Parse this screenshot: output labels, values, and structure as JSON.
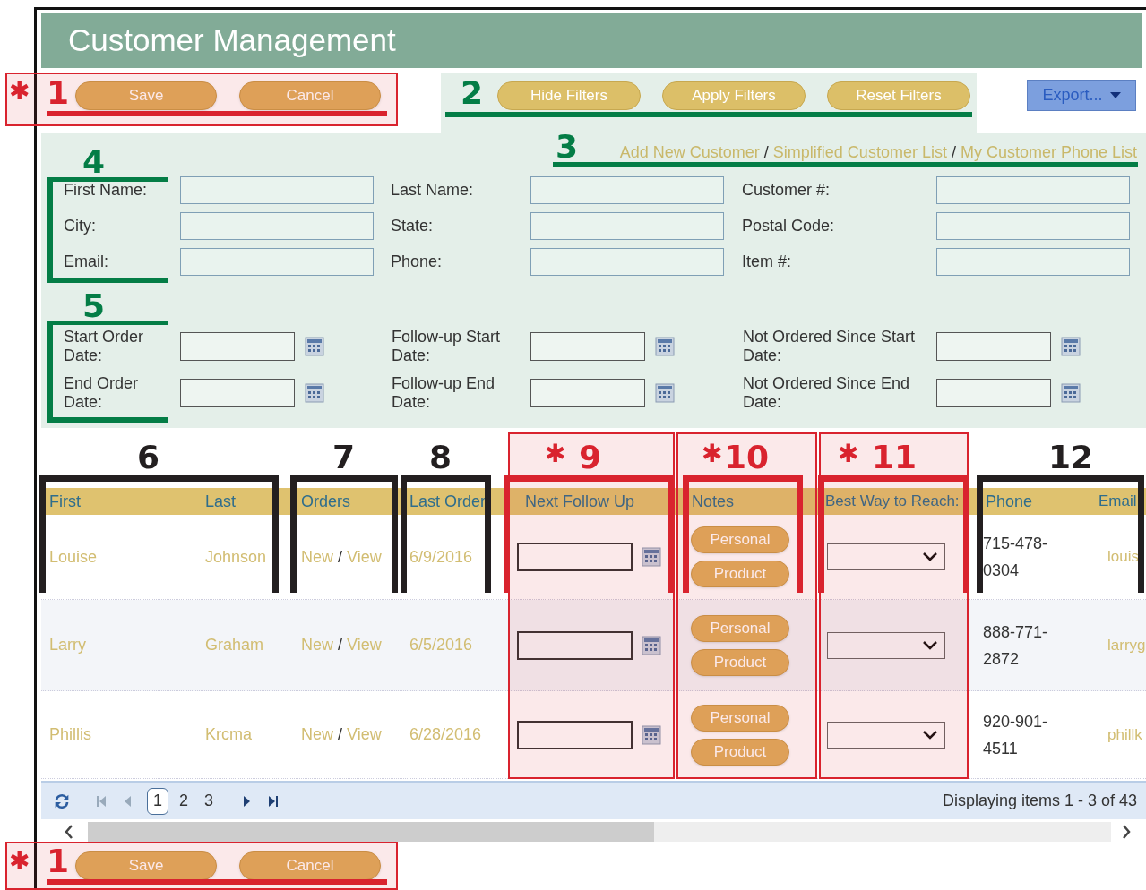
{
  "title": "Customer Management",
  "action_buttons": [
    "Save",
    "Cancel"
  ],
  "filter_buttons": [
    "Hide Filters",
    "Apply Filters",
    "Reset Filters"
  ],
  "export_button": {
    "label": "Export..."
  },
  "links": [
    {
      "label": "Add New Customer"
    },
    {
      "label": "Simplified Customer List",
      "separator": "/"
    },
    {
      "label": "My Customer Phone List",
      "separator": "/"
    }
  ],
  "search_fields": [
    {
      "label": "First Name:"
    },
    {
      "label": "Last Name:"
    },
    {
      "label": "Customer #:"
    },
    {
      "label": "City:"
    },
    {
      "label": "State:"
    },
    {
      "label": "Postal Code:"
    },
    {
      "label": "Email:"
    },
    {
      "label": "Phone:"
    },
    {
      "label": "Item #:"
    }
  ],
  "date_fields": [
    {
      "label": "Start Order Date:"
    },
    {
      "label": "Follow-up Start Date:"
    },
    {
      "label": "Not Ordered Since Start Date:"
    },
    {
      "label": "End Order Date:"
    },
    {
      "label": "Follow-up End Date:"
    },
    {
      "label": "Not Ordered Since End Date:"
    }
  ],
  "table": {
    "columns": [
      "First",
      "Last",
      "Orders",
      "Last Order",
      "Next Follow Up",
      "Notes",
      "Best Way to Reach:",
      "Phone",
      "Email"
    ],
    "rows": [
      {
        "first": "Louise",
        "last": "Johnson",
        "order_new": "New",
        "order_separator": "/",
        "order_view": "View",
        "last_order": "6/9/2016",
        "notes": [
          "Personal",
          "Product"
        ],
        "phone": "715-478-0304",
        "email": "louis"
      },
      {
        "first": "Larry",
        "last": "Graham",
        "order_new": "New",
        "order_separator": "/",
        "order_view": "View",
        "last_order": "6/5/2016",
        "notes": [
          "Personal",
          "Product"
        ],
        "phone": "888-771-2872",
        "email": "larryg"
      },
      {
        "first": "Phillis",
        "last": "Krcma",
        "order_new": "New",
        "order_separator": "/",
        "order_view": "View",
        "last_order": "6/28/2016",
        "notes": [
          "Personal",
          "Product"
        ],
        "phone": "920-901-4511",
        "email": "phillk"
      }
    ]
  },
  "pager": {
    "pages": [
      {
        "label": "1",
        "selected": true
      },
      {
        "label": "2",
        "selected": false
      },
      {
        "label": "3",
        "selected": false
      }
    ],
    "summary": "Displaying items 1 - 3 of 43"
  },
  "bottom_buttons": [
    "Save",
    "Cancel"
  ],
  "annotations": [
    {
      "number": "1",
      "asterisk": "✱",
      "color": "#d9232e"
    },
    {
      "number": "2",
      "color": "#047d46"
    },
    {
      "number": "3",
      "color": "#047d46"
    },
    {
      "number": "4",
      "color": "#047d46"
    },
    {
      "number": "5",
      "color": "#047d46"
    },
    {
      "number": "6",
      "color": "#231f20"
    },
    {
      "number": "7",
      "color": "#231f20"
    },
    {
      "number": "8",
      "color": "#231f20"
    },
    {
      "number": "9",
      "asterisk": "✱",
      "color": "#d9232e"
    },
    {
      "number": "10",
      "asterisk": "✱",
      "color": "#d9232e"
    },
    {
      "number": "11",
      "asterisk": "✱",
      "color": "#d9232e"
    },
    {
      "number": "12",
      "color": "#231f20"
    },
    {
      "number": "1",
      "asterisk": "✱",
      "color": "#d9232e"
    }
  ]
}
